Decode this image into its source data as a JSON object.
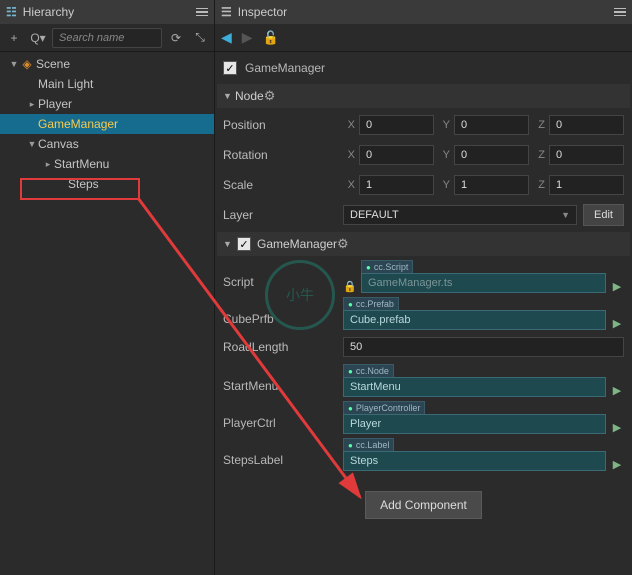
{
  "hierarchy": {
    "title": "Hierarchy",
    "search_placeholder": "Search name",
    "nodes": {
      "scene": "Scene",
      "main_light": "Main Light",
      "player": "Player",
      "game_manager": "GameManager",
      "canvas": "Canvas",
      "start_menu": "StartMenu",
      "steps": "Steps"
    }
  },
  "inspector": {
    "title": "Inspector",
    "object_name": "GameManager",
    "node_section": "Node",
    "position_label": "Position",
    "rotation_label": "Rotation",
    "scale_label": "Scale",
    "layer_label": "Layer",
    "layer_value": "DEFAULT",
    "edit_label": "Edit",
    "position": {
      "x": "0",
      "y": "0",
      "z": "0"
    },
    "rotation": {
      "x": "0",
      "y": "0",
      "z": "0"
    },
    "scale": {
      "x": "1",
      "y": "1",
      "z": "1"
    },
    "axis": {
      "x": "X",
      "y": "Y",
      "z": "Z"
    },
    "component_name": "GameManager",
    "script": {
      "label": "Script",
      "type": "cc.Script",
      "value": "GameManager.ts"
    },
    "cubePrfb": {
      "label": "CubePrfb",
      "type": "cc.Prefab",
      "value": "Cube.prefab"
    },
    "roadLength": {
      "label": "RoadLength",
      "value": "50"
    },
    "startMenu": {
      "label": "StartMenu",
      "type": "cc.Node",
      "value": "StartMenu"
    },
    "playerCtrl": {
      "label": "PlayerCtrl",
      "type": "PlayerController",
      "value": "Player"
    },
    "stepsLabel": {
      "label": "StepsLabel",
      "type": "cc.Label",
      "value": "Steps"
    },
    "add_component": "Add Component"
  },
  "watermark_text": "小牛"
}
